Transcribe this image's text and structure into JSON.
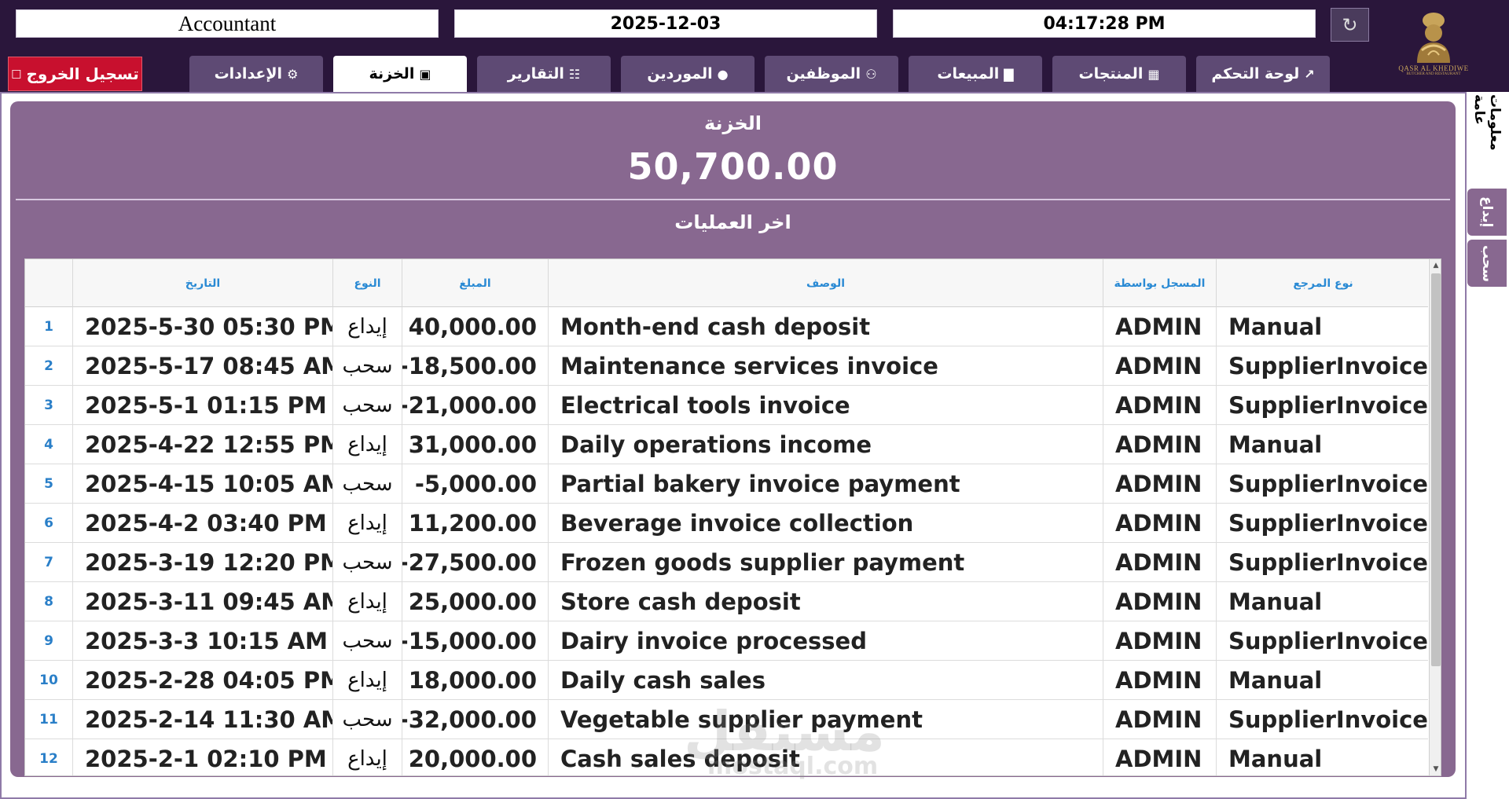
{
  "header": {
    "user": "Accountant",
    "date": "2025-12-03",
    "time": "04:17:28 PM",
    "refresh_icon": "refresh-icon",
    "logo_text": "QASR AL KHEDIWE",
    "logo_sub": "BUTCHER AND RESTAURANT"
  },
  "nav": {
    "logout": "تسجيل الخروج",
    "tabs": [
      {
        "label": "الإعدادات",
        "icon": "gear-icon"
      },
      {
        "label": "الخزنة",
        "icon": "cash-icon"
      },
      {
        "label": "التقارير",
        "icon": "report-icon"
      },
      {
        "label": "الموردين",
        "icon": "supplier-icon"
      },
      {
        "label": "الموظفين",
        "icon": "employees-icon"
      },
      {
        "label": "المبيعات",
        "icon": "sales-icon"
      },
      {
        "label": "المنتجات",
        "icon": "products-icon"
      },
      {
        "label": "لوحة التحكم",
        "icon": "dashboard-icon"
      }
    ],
    "active_tab": "الخزنة"
  },
  "treasury": {
    "title": "الخزنة",
    "balance": "50,700.00",
    "recent_title": "اخر العمليات"
  },
  "side": {
    "info": "معلومات عامة",
    "deposit": "إيداع",
    "withdraw": "سحب"
  },
  "table": {
    "columns": {
      "date": "التاريخ",
      "type": "النوع",
      "amount": "المبلغ",
      "desc": "الوصف",
      "by": "المسجل بواسطة",
      "ref": "نوع المرجع"
    },
    "rows": [
      {
        "n": "1",
        "date": "2025-5-30 05:30 PM",
        "type": "إيداع",
        "amount": "40,000.00",
        "desc": "Month-end cash deposit",
        "by": "ADMIN",
        "ref": "Manual"
      },
      {
        "n": "2",
        "date": "2025-5-17 08:45 AM",
        "type": "سحب",
        "amount": "-18,500.00",
        "desc": "Maintenance services invoice",
        "by": "ADMIN",
        "ref": "SupplierInvoice"
      },
      {
        "n": "3",
        "date": "2025-5-1 01:15 PM",
        "type": "سحب",
        "amount": "-21,000.00",
        "desc": "Electrical tools invoice",
        "by": "ADMIN",
        "ref": "SupplierInvoice"
      },
      {
        "n": "4",
        "date": "2025-4-22 12:55 PM",
        "type": "إيداع",
        "amount": "31,000.00",
        "desc": "Daily operations income",
        "by": "ADMIN",
        "ref": "Manual"
      },
      {
        "n": "5",
        "date": "2025-4-15 10:05 AM",
        "type": "سحب",
        "amount": "-5,000.00",
        "desc": "Partial bakery invoice payment",
        "by": "ADMIN",
        "ref": "SupplierInvoice"
      },
      {
        "n": "6",
        "date": "2025-4-2 03:40 PM",
        "type": "إيداع",
        "amount": "11,200.00",
        "desc": "Beverage invoice collection",
        "by": "ADMIN",
        "ref": "SupplierInvoice"
      },
      {
        "n": "7",
        "date": "2025-3-19 12:20 PM",
        "type": "سحب",
        "amount": "-27,500.00",
        "desc": "Frozen goods supplier payment",
        "by": "ADMIN",
        "ref": "SupplierInvoice"
      },
      {
        "n": "8",
        "date": "2025-3-11 09:45 AM",
        "type": "إيداع",
        "amount": "25,000.00",
        "desc": "Store cash deposit",
        "by": "ADMIN",
        "ref": "Manual"
      },
      {
        "n": "9",
        "date": "2025-3-3 10:15 AM",
        "type": "سحب",
        "amount": "-15,000.00",
        "desc": "Dairy invoice processed",
        "by": "ADMIN",
        "ref": "SupplierInvoice"
      },
      {
        "n": "10",
        "date": "2025-2-28 04:05 PM",
        "type": "إيداع",
        "amount": "18,000.00",
        "desc": "Daily cash sales",
        "by": "ADMIN",
        "ref": "Manual"
      },
      {
        "n": "11",
        "date": "2025-2-14 11:30 AM",
        "type": "سحب",
        "amount": "-32,000.00",
        "desc": "Vegetable supplier payment",
        "by": "ADMIN",
        "ref": "SupplierInvoice"
      },
      {
        "n": "12",
        "date": "2025-2-1 02:10 PM",
        "type": "إيداع",
        "amount": "20,000.00",
        "desc": "Cash sales deposit",
        "by": "ADMIN",
        "ref": "Manual"
      }
    ]
  },
  "watermark": {
    "main": "مستقل",
    "sub": "mostaql.com"
  },
  "colors": {
    "topbar": "#2a163b",
    "panel": "#886890",
    "tab": "#5e4a74",
    "logout": "#c8102e",
    "header_text": "#2a8ad4"
  }
}
